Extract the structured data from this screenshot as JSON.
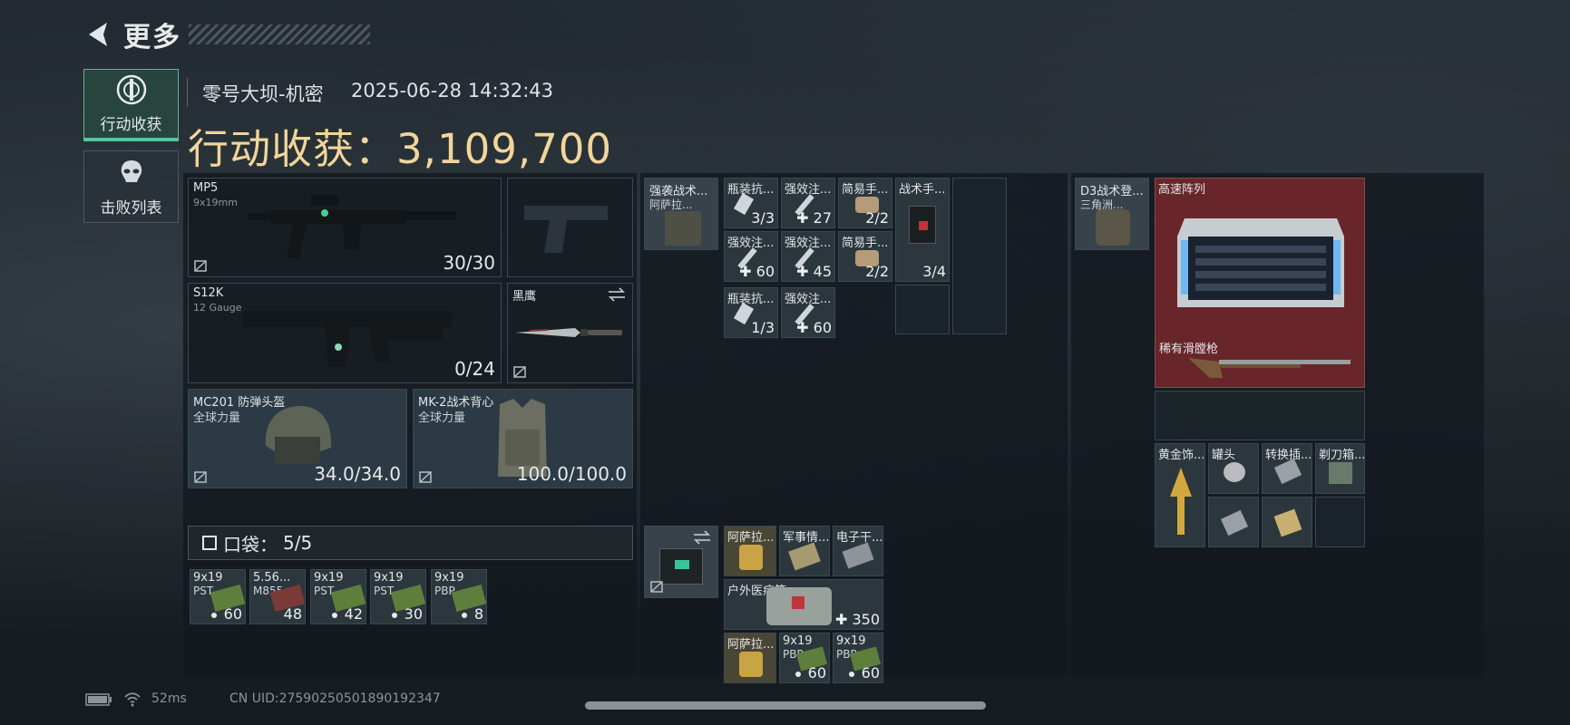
{
  "nav": {
    "title": "更多"
  },
  "sidebar": {
    "items": [
      {
        "label": "行动收获",
        "icon": "target-icon",
        "active": true
      },
      {
        "label": "击败列表",
        "icon": "skull-icon",
        "active": false
      }
    ]
  },
  "header": {
    "map": "零号大坝-机密",
    "datetime": "2025-06-28 14:32:43",
    "total_label": "行动收获：",
    "total_value": "3,109,700"
  },
  "equipment": {
    "primary": {
      "name": "MP5",
      "sub": "9x19mm",
      "ammo": "30/30"
    },
    "secondary": {
      "name": "S12K",
      "sub": "12 Gauge",
      "ammo": "0/24"
    },
    "melee": {
      "name": "黑鹰"
    },
    "helmet": {
      "name": "MC201 防弹头盔",
      "sub": "全球力量",
      "durability": "34.0/34.0"
    },
    "armor": {
      "name": "MK-2战术背心",
      "sub": "全球力量",
      "durability": "100.0/100.0"
    }
  },
  "pockets": {
    "label": "口袋：",
    "value": "5/5",
    "items": [
      {
        "name": "9x19",
        "sub": "PST",
        "count": "60",
        "dot": true
      },
      {
        "name": "5.56...",
        "sub": "M855",
        "count": "48",
        "dot": false
      },
      {
        "name": "9x19",
        "sub": "PST",
        "count": "42",
        "dot": true
      },
      {
        "name": "9x19",
        "sub": "PST",
        "count": "30",
        "dot": true
      },
      {
        "name": "9x19",
        "sub": "PBP",
        "count": "8",
        "dot": true
      }
    ]
  },
  "rig": {
    "item": {
      "name": "强袭战术...",
      "sub": "阿萨拉..."
    },
    "slots": [
      {
        "name": "瓶装抗...",
        "value": "3/3"
      },
      {
        "name": "强效注...",
        "value": "27"
      },
      {
        "name": "简易手...",
        "value": "2/2"
      },
      {
        "name": "战术手...",
        "value": "3/4"
      },
      {
        "name": "强效注...",
        "value": "60"
      },
      {
        "name": "强效注...",
        "value": "45"
      },
      {
        "name": "简易手...",
        "value": "2/2"
      },
      {
        "name": "瓶装抗...",
        "value": "1/3"
      },
      {
        "name": "强效注...",
        "value": "60"
      }
    ]
  },
  "pouch": {
    "slots": [
      {
        "name": "阿萨拉..."
      },
      {
        "name": "军事情..."
      },
      {
        "name": "电子干..."
      },
      {
        "name": "户外医疗箱",
        "value": "350"
      },
      {
        "name": "阿萨拉..."
      },
      {
        "name": "9x19",
        "sub": "PBP",
        "value": "60"
      },
      {
        "name": "9x19",
        "sub": "PBP",
        "value": "60"
      }
    ]
  },
  "backpack": {
    "item": {
      "name": "D3战术登...",
      "sub": "三角洲..."
    },
    "slots": [
      {
        "name": "高速阵列"
      },
      {
        "name": "稀有滑膛枪"
      },
      {
        "name": "黄金饰..."
      },
      {
        "name": "罐头"
      },
      {
        "name": "转换插..."
      },
      {
        "name": "剃刀箱..."
      }
    ]
  },
  "status": {
    "ping": "52ms",
    "uid": "CN UID:27590250501890192347"
  },
  "colors": {
    "accent": "#f1d59a",
    "active_tab": "#5cc3a0",
    "rare_red": "#78282c"
  }
}
